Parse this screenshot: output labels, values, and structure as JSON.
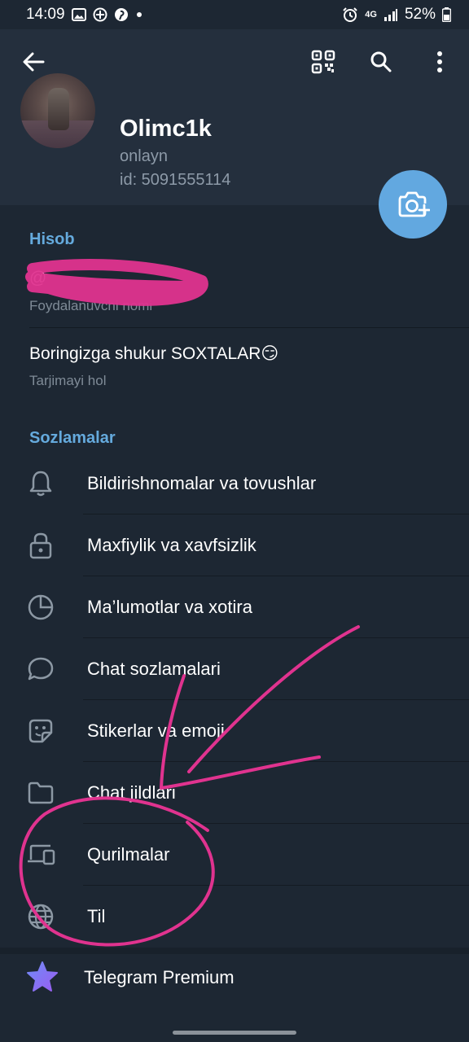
{
  "status_bar": {
    "time": "14:09",
    "network": "4G",
    "battery": "52%",
    "icons": [
      "gallery-icon",
      "location-icon",
      "pinterest-icon",
      "dot-icon",
      "alarm-icon",
      "signal-icon",
      "battery-icon"
    ]
  },
  "topbar": {
    "icons": [
      "back-arrow-icon",
      "qr-code-icon",
      "search-icon",
      "more-vertical-icon"
    ]
  },
  "profile": {
    "name": "Olimc1k",
    "status": "onlayn",
    "id": "id: 5091555114"
  },
  "account": {
    "title": "Hisob",
    "username_label": "Foydalanuvchi nomi",
    "bio_value": "Boringizga shukur SOXTALAR😏",
    "bio_label": "Tarjimayi hol"
  },
  "settings": {
    "title": "Sozlamalar",
    "items": [
      {
        "label": "Bildirishnomalar va tovushlar",
        "icon": "bell-icon"
      },
      {
        "label": "Maxfiylik va xavfsizlik",
        "icon": "lock-icon"
      },
      {
        "label": "Ma’lumotlar va xotira",
        "icon": "pie-chart-icon"
      },
      {
        "label": "Chat sozlamalari",
        "icon": "chat-bubble-icon"
      },
      {
        "label": "Stikerlar va emoji",
        "icon": "sticker-icon"
      },
      {
        "label": "Chat jildlari",
        "icon": "folder-icon"
      },
      {
        "label": "Qurilmalar",
        "icon": "devices-icon"
      },
      {
        "label": "Til",
        "icon": "globe-icon"
      }
    ],
    "premium_label": "Telegram Premium"
  },
  "colors": {
    "background": "#1d2733",
    "header": "#242f3d",
    "accent": "#65aadd",
    "fab": "#62a8e0",
    "annotation": "#e0338f",
    "premium_star": "#7b6cf0"
  }
}
